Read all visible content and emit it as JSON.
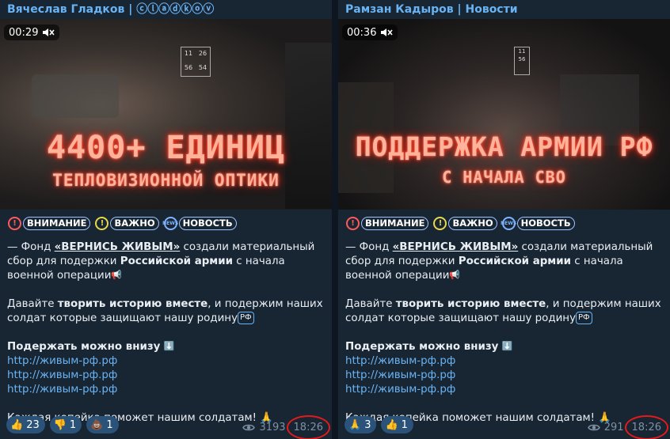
{
  "posts": [
    {
      "channel": "Вячеслав Гладков | ⓒⓛⓐⓓⓚⓞⓥ",
      "duration": "00:29",
      "video_title_line1": "4400+ ЕДИНИЦ",
      "video_title_line2": "ТЕПЛОВИЗИОННОЙ ОПТИКИ",
      "tags": [
        "ВНИМАНИЕ",
        "ВАЖНО",
        "НОВОСТЬ"
      ],
      "text_intro": "— Фонд ",
      "text_fund": "«ВЕРНИСЬ ЖИВЫМ»",
      "text_mid": " создали материальный сбор для подержки ",
      "text_army": "Российской армии",
      "text_end": " с начала военной операции",
      "text2_a": "Давайте ",
      "text2_b": "творить историю вместе",
      "text2_c": ",  и подержим наших солдат которые защищают нашу родину",
      "support": "Подержать можно внизу",
      "links": [
        "http://живым-рф.рф",
        "http://живым-рф.рф",
        "http://живым-рф.рф"
      ],
      "closing": "Каждая копейка поможет нашим солдатам!",
      "reactions": [
        {
          "icon": "👍",
          "count": "23"
        },
        {
          "icon": "👎",
          "count": "1"
        },
        {
          "icon": "💩",
          "count": "1"
        }
      ],
      "views": "3193",
      "time": "18:26"
    },
    {
      "channel": "Рамзан Кадыров | Новости",
      "duration": "00:36",
      "video_title_line1": "ПОДДЕРЖКА АРМИИ РФ",
      "video_title_line2": "С НАЧАЛА СВО",
      "tags": [
        "ВНИМАНИЕ",
        "ВАЖНО",
        "НОВОСТЬ"
      ],
      "text_intro": "— Фонд ",
      "text_fund": "«ВЕРНИСЬ ЖИВЫМ»",
      "text_mid": " создали материальный сбор для подержки ",
      "text_army": "Российской армии",
      "text_end": " с начала военной операции",
      "text2_a": "Давайте ",
      "text2_b": "творить историю вместе",
      "text2_c": ",  и подержим наших солдат которые защищают нашу родину",
      "support": "Подержать можно внизу",
      "links": [
        "http://живым-рф.рф",
        "http://живым-рф.рф",
        "http://живым-рф.рф"
      ],
      "closing": "Каждая копейка поможет нашим солдатам!",
      "reactions": [
        {
          "icon": "🙏",
          "count": "3"
        },
        {
          "icon": "👍",
          "count": "1"
        }
      ],
      "views": "291",
      "time": "18:26"
    }
  ],
  "icons": {
    "mute": "speaker-muted-icon",
    "eye": "eye-icon",
    "megaphone": "megaphone-icon",
    "arrow_down": "arrow-down-icon",
    "pray": "folded-hands-icon",
    "rf": "РФ"
  },
  "colors": {
    "background": "#0e1621",
    "bubble": "#182533",
    "link": "#6ab3f3",
    "reaction": "#2b5278",
    "highlight_circle": "#e21b1b"
  }
}
